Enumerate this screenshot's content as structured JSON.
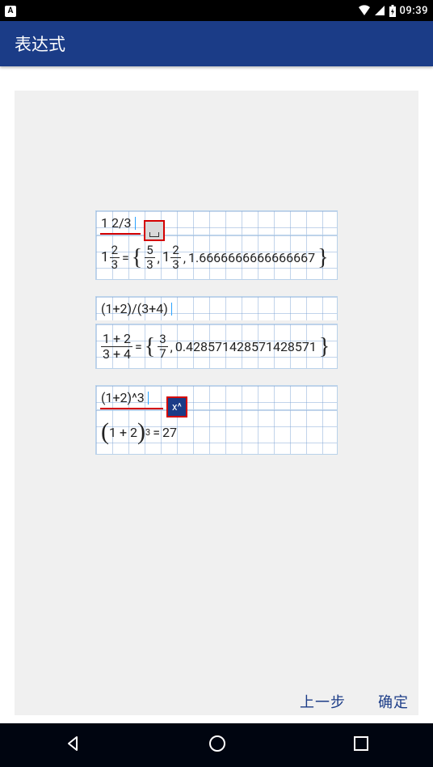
{
  "statusbar": {
    "indicator": "A",
    "clock": "09:39"
  },
  "appbar": {
    "title": "表达式"
  },
  "examples": [
    {
      "input": "1 2/3",
      "output_text_decimal": "1.6666666666666667",
      "output_whole": "1",
      "frac1_num": "5",
      "frac1_den": "3",
      "mixed_whole": "1",
      "mixed_num": "2",
      "mixed_den": "3"
    },
    {
      "input": "(1+2)/(3+4)",
      "bigfrac_num": "1 + 2",
      "bigfrac_den": "3 + 4",
      "frac_num": "3",
      "frac_den": "7",
      "output_decimal": "0.428571428571428571"
    },
    {
      "input": "(1+2)^3",
      "base": "1 + 2",
      "exp": "3",
      "result": "27",
      "badge": "x^"
    }
  ],
  "dialog": {
    "prev": "上一步",
    "ok": "确定"
  }
}
